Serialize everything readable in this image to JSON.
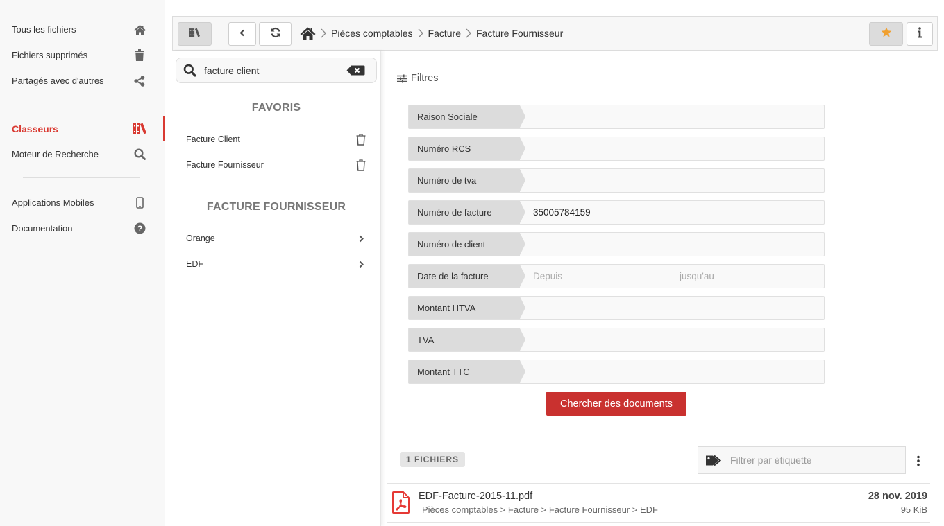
{
  "nav": {
    "items": [
      {
        "label": "Tous les fichiers",
        "icon": "home-icon"
      },
      {
        "label": "Fichiers supprimés",
        "icon": "trash-icon"
      },
      {
        "label": "Partagés avec d'autres",
        "icon": "share-icon"
      },
      {
        "label": "Classeurs",
        "icon": "books-icon",
        "active": true
      },
      {
        "label": "Moteur de Recherche",
        "icon": "search-icon"
      },
      {
        "label": "Applications Mobiles",
        "icon": "mobile-icon"
      },
      {
        "label": "Documentation",
        "icon": "question-circle-icon"
      }
    ]
  },
  "toolbar": {
    "breadcrumb": [
      "Pièces comptables",
      "Facture",
      "Facture Fournisseur"
    ],
    "favorite_active": true,
    "accent_star": "#f0a030"
  },
  "sidepanel": {
    "search": {
      "value": "facture client"
    },
    "favorites_title": "FAVORIS",
    "favorites": [
      {
        "label": "Facture Client"
      },
      {
        "label": "Facture Fournisseur"
      }
    ],
    "folder_title": "FACTURE FOURNISSEUR",
    "folders": [
      {
        "label": "Orange"
      },
      {
        "label": "EDF"
      }
    ]
  },
  "filters": {
    "title": "Filtres",
    "fields": [
      {
        "label": "Raison Sociale",
        "value": ""
      },
      {
        "label": "Numéro RCS",
        "value": ""
      },
      {
        "label": "Numéro de tva",
        "value": ""
      },
      {
        "label": "Numéro de facture",
        "value": "35005784159"
      },
      {
        "label": "Numéro de client",
        "value": ""
      },
      {
        "label": "Date de la facture",
        "from_placeholder": "Depuis",
        "to_placeholder": "jusqu'au"
      },
      {
        "label": "Montant HTVA",
        "value": ""
      },
      {
        "label": "TVA",
        "value": ""
      },
      {
        "label": "Montant TTC",
        "value": ""
      }
    ],
    "search_button": "Chercher des documents"
  },
  "results": {
    "count_label": "1 FICHIERS",
    "tag_filter_placeholder": "Filtrer par étiquette",
    "files": [
      {
        "name": "EDF-Facture-2015-11.pdf",
        "path": "Pièces comptables > Facture > Facture Fournisseur > EDF",
        "date": "28 nov. 2019",
        "size": "95 KiB",
        "type": "pdf"
      }
    ]
  },
  "colors": {
    "accent": "#d93a32",
    "button": "#c9312f",
    "pdf": "#e53935"
  }
}
